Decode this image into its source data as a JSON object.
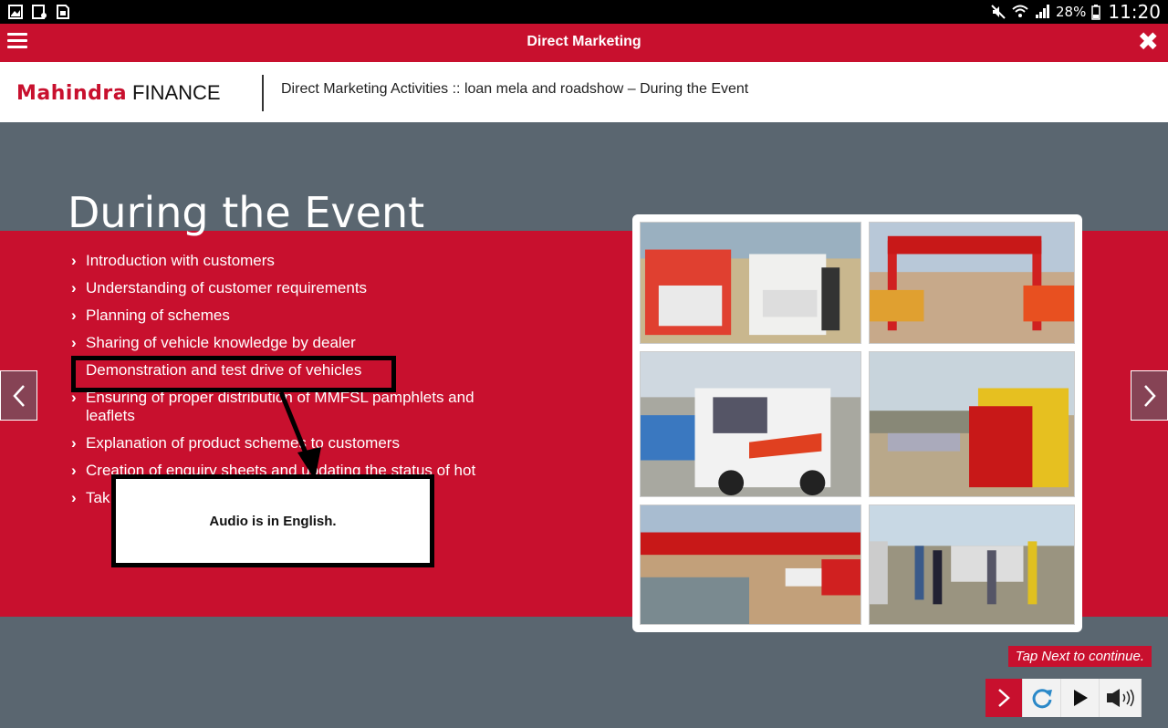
{
  "status_bar": {
    "battery": "28%",
    "time": "11:20"
  },
  "app_bar": {
    "title": "Direct Marketing",
    "close_icon": "close-icon",
    "menu_icon": "hamburger-menu-icon"
  },
  "header": {
    "logo_brand": "Mahindra",
    "logo_suffix": "FINANCE",
    "breadcrumb": "Direct Marketing Activities :: loan mela and roadshow – During the Event"
  },
  "slide": {
    "title": "During the Event",
    "bullets": [
      "Introduction with customers",
      "Understanding of customer requirements",
      "Planning of schemes",
      "Sharing of vehicle knowledge by dealer",
      "Demonstration and test drive of vehicles",
      "Ensuring of proper distribution of MMFSL pamphlets and leaflets",
      "Explanation of product schemes to customers",
      "Creation of enquiry sheets and updating the status of hot",
      "Tak them acro"
    ],
    "popup_text": "Audio is in English.",
    "tap_hint": "Tap Next to continue."
  },
  "colors": {
    "brand_red": "#c8102e",
    "slide_gray": "#5a6670"
  }
}
